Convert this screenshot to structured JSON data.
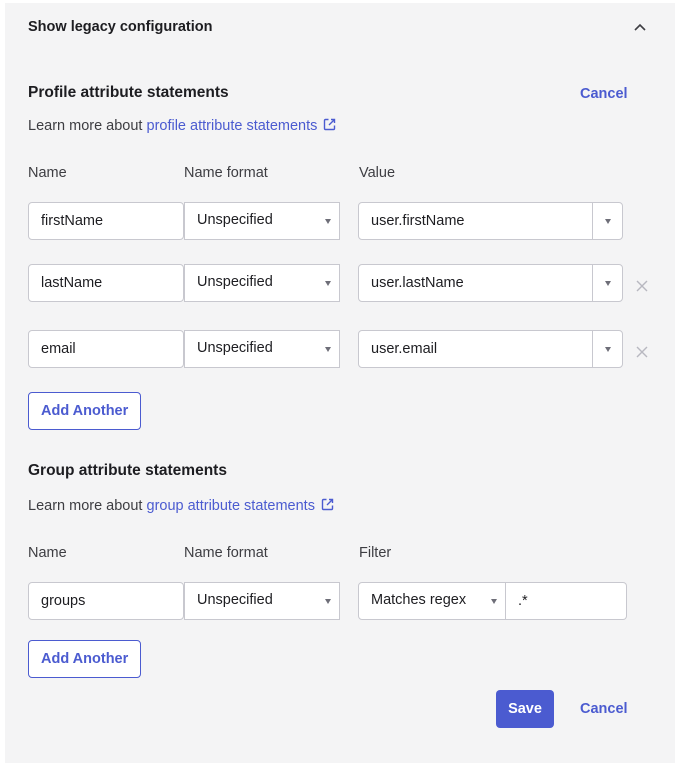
{
  "legacy": {
    "title": "Show legacy configuration"
  },
  "profile": {
    "title": "Profile attribute statements",
    "cancel_label": "Cancel",
    "learn_prefix": "Learn more about ",
    "learn_link": "profile attribute statements",
    "columns": {
      "name": "Name",
      "format": "Name format",
      "value": "Value"
    },
    "rows": [
      {
        "name": "firstName",
        "format": "Unspecified",
        "value": "user.firstName"
      },
      {
        "name": "lastName",
        "format": "Unspecified",
        "value": "user.lastName"
      },
      {
        "name": "email",
        "format": "Unspecified",
        "value": "user.email"
      }
    ],
    "add_label": "Add Another"
  },
  "group": {
    "title": "Group attribute statements",
    "learn_prefix": "Learn more about ",
    "learn_link": "group attribute statements",
    "columns": {
      "name": "Name",
      "format": "Name format",
      "filter": "Filter"
    },
    "rows": [
      {
        "name": "groups",
        "format": "Unspecified",
        "filter_type": "Matches regex",
        "filter_value": ".*"
      }
    ],
    "add_label": "Add Another"
  },
  "footer": {
    "save_label": "Save",
    "cancel_label": "Cancel"
  },
  "colors": {
    "accent": "#4b5bd0",
    "panel_bg": "#f4f4f5",
    "border": "#c8c8cf"
  }
}
